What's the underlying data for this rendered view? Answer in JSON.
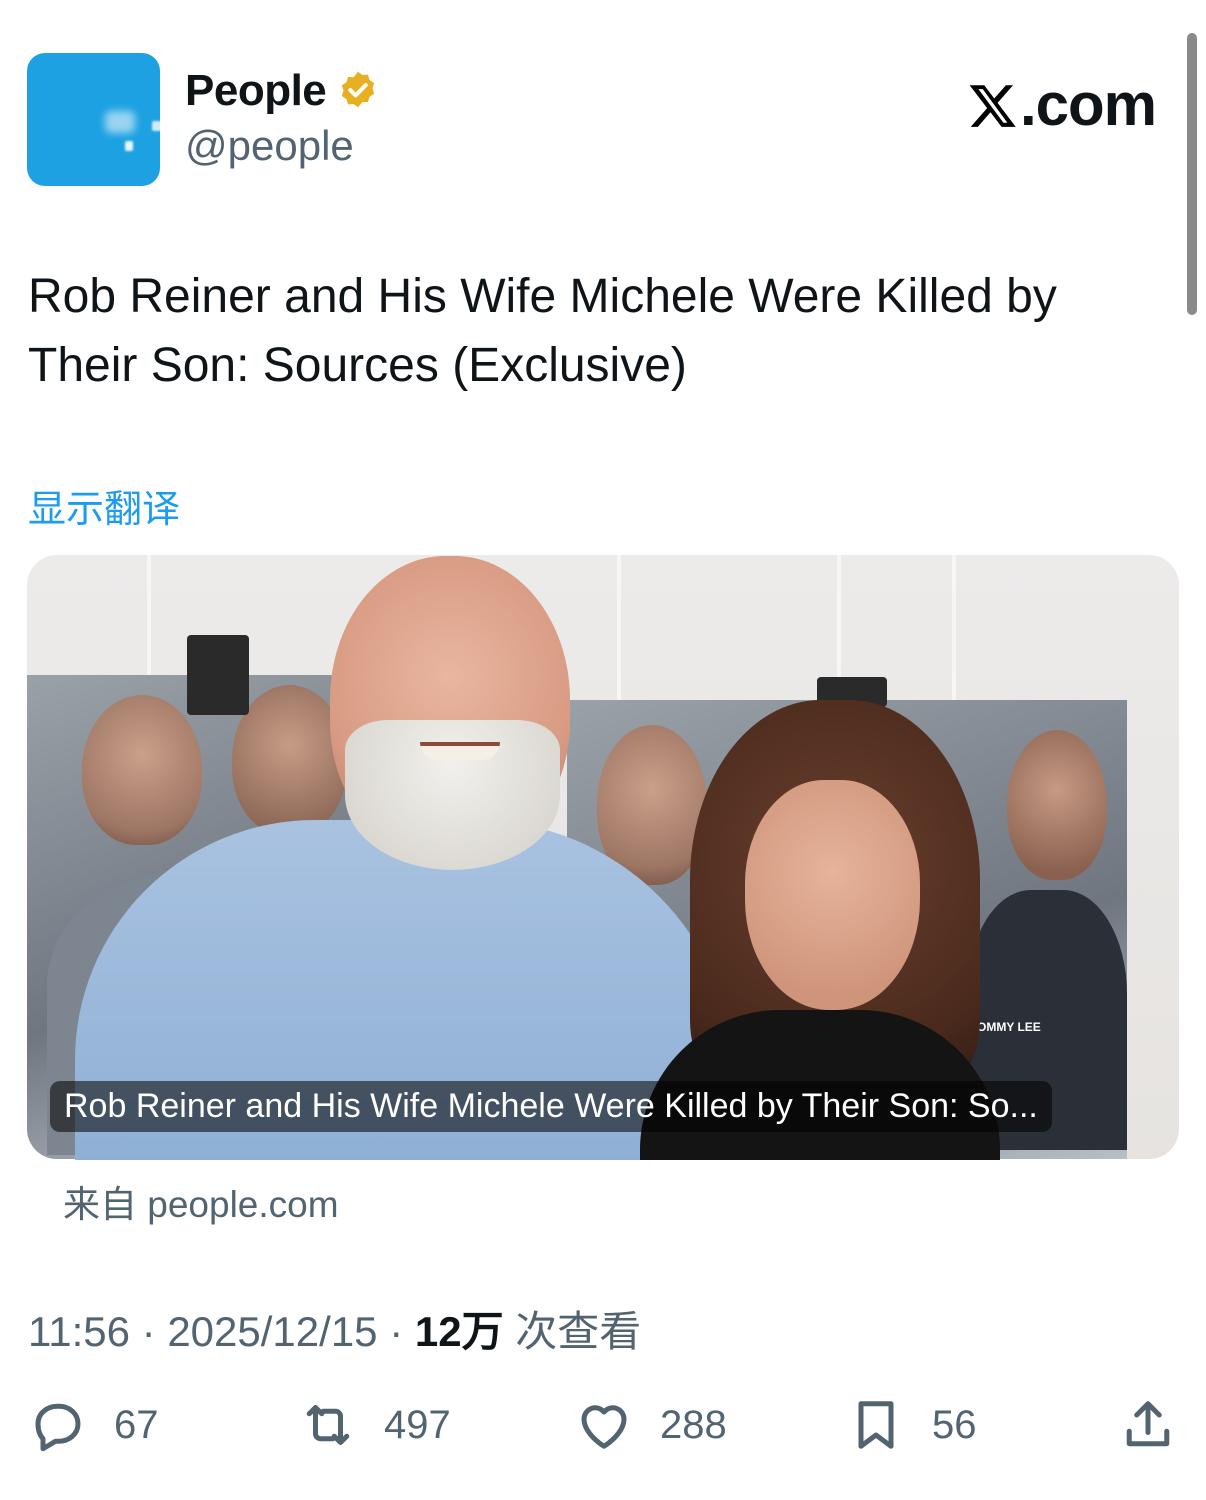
{
  "account": {
    "display_name": "People",
    "handle": "@people",
    "verified": true,
    "badge_color": "#e8b020",
    "avatar_color": "#1da1e2"
  },
  "brand": {
    "label": ".com",
    "icon": "x-logo-icon"
  },
  "tweet": {
    "text": "Rob Reiner and His Wife Michele Were Killed by Their Son: Sources (Exclusive)",
    "translate_label": "显示翻译"
  },
  "card": {
    "caption": "Rob Reiner and His Wife Michele Were Killed by Their Son: So...",
    "source": "来自 people.com",
    "poster_text": "OMMY LEE"
  },
  "meta": {
    "time": "11:56",
    "date": "2025/12/15",
    "views_count": "12万",
    "views_label": "次查看"
  },
  "actions": {
    "replies": "67",
    "reposts": "497",
    "likes": "288",
    "bookmarks": "56"
  },
  "colors": {
    "link": "#1d9bf0",
    "secondary_text": "#536471",
    "primary_text": "#0f1419"
  }
}
